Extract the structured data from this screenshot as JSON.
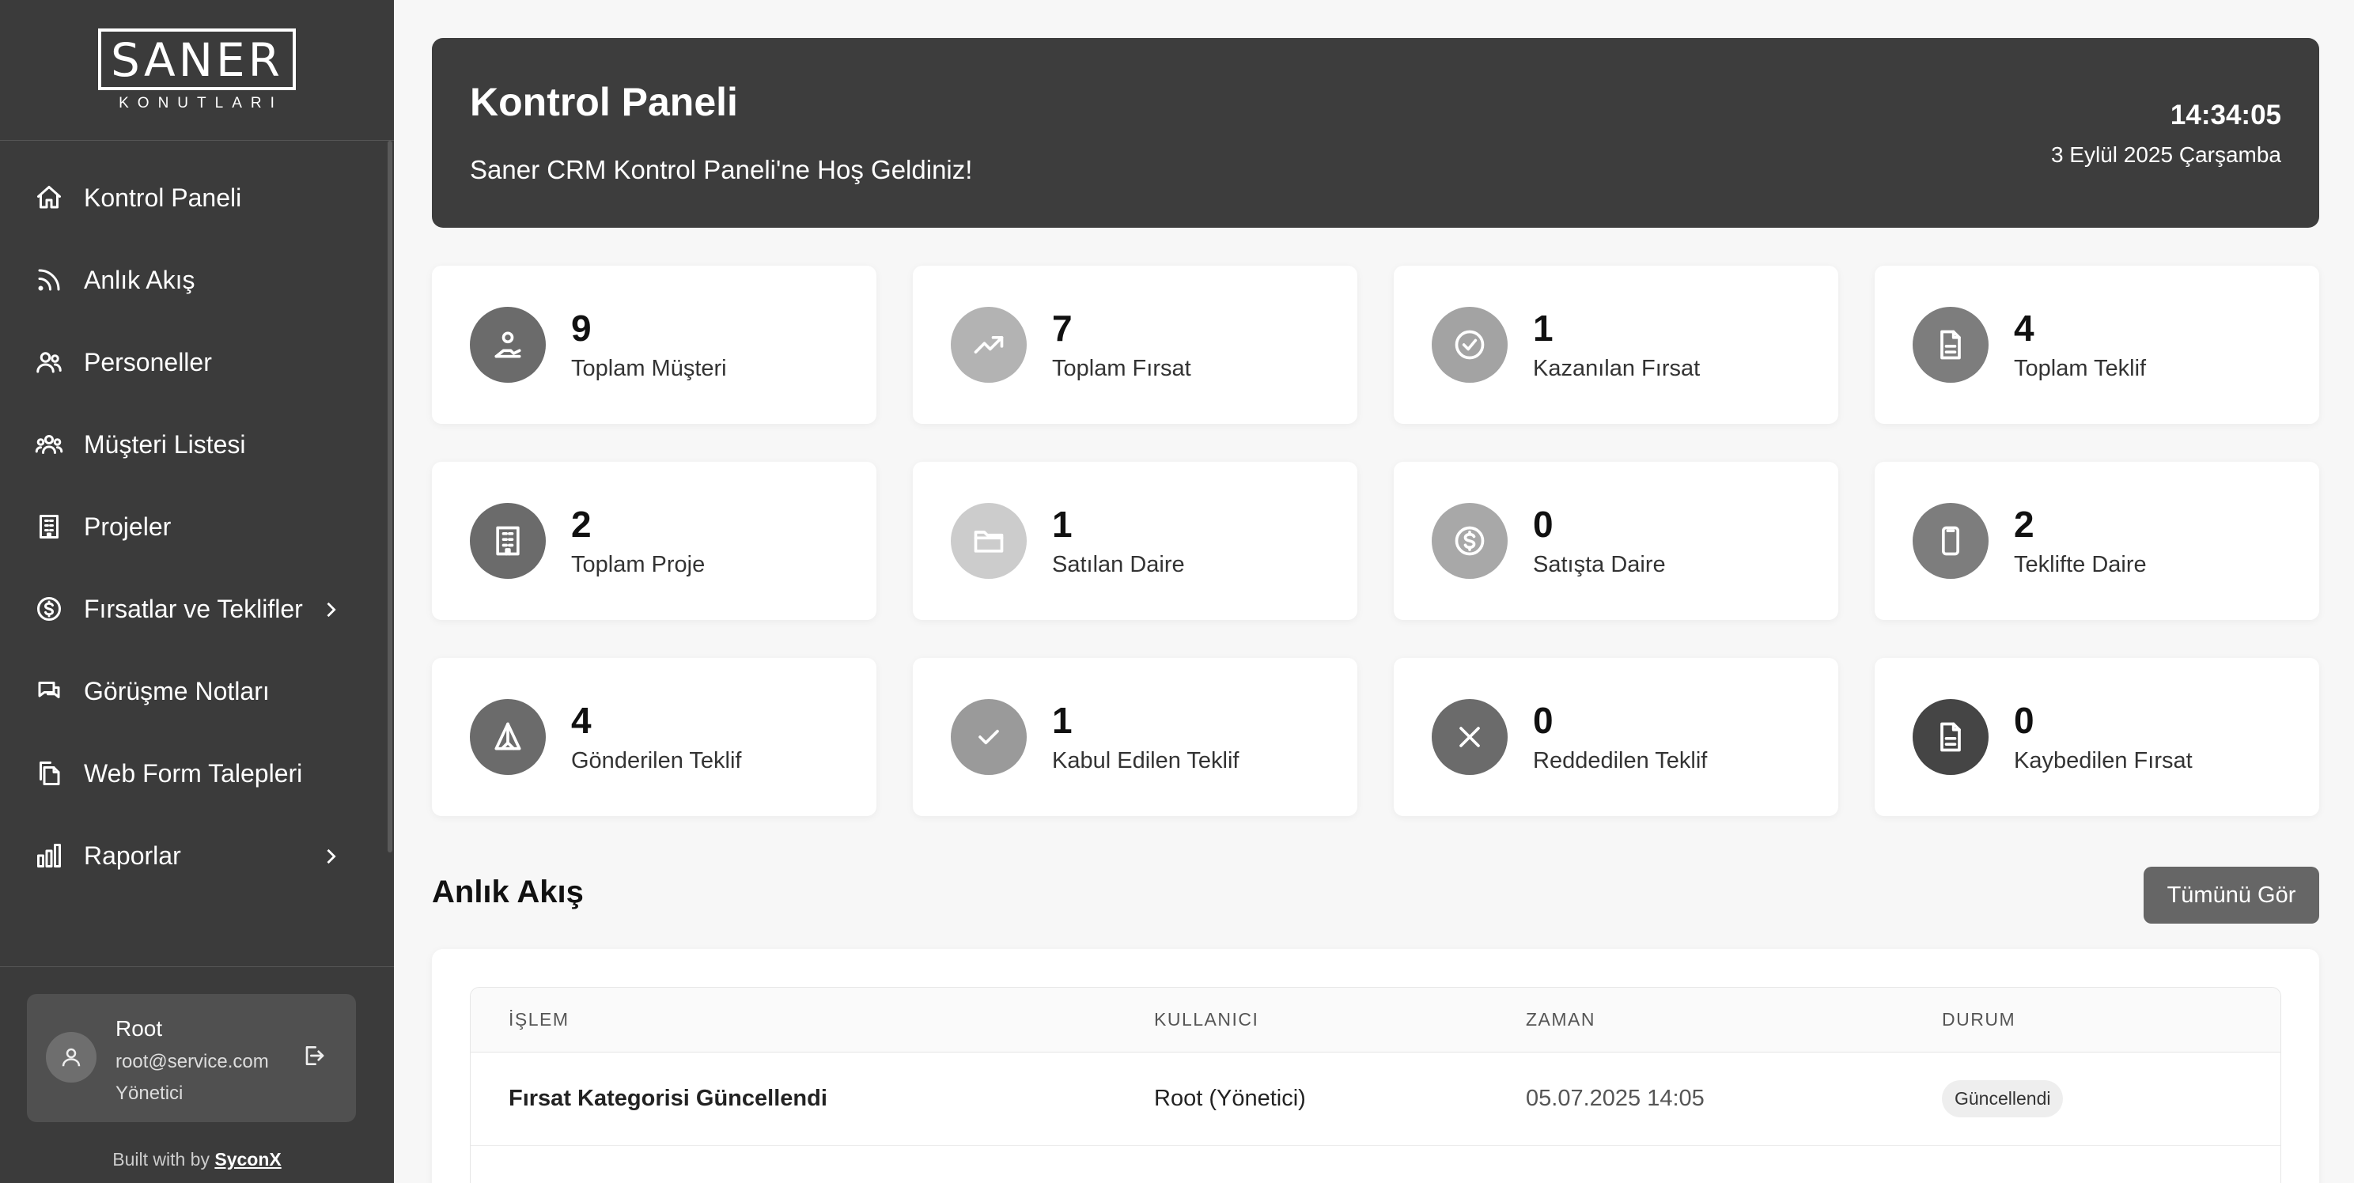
{
  "brand": {
    "name": "SANER",
    "sub": "KONUTLARI"
  },
  "sidebar": {
    "items": [
      {
        "label": "Kontrol Paneli",
        "icon": "home-icon"
      },
      {
        "label": "Anlık Akış",
        "icon": "rss-icon"
      },
      {
        "label": "Personeller",
        "icon": "users-icon"
      },
      {
        "label": "Müşteri Listesi",
        "icon": "user-group-icon"
      },
      {
        "label": "Projeler",
        "icon": "building-icon"
      },
      {
        "label": "Fırsatlar ve Teklifler",
        "icon": "dollar-circle-icon",
        "has_children": true
      },
      {
        "label": "Görüşme Notları",
        "icon": "chat-icon"
      },
      {
        "label": "Web Form Talepleri",
        "icon": "documents-icon"
      },
      {
        "label": "Raporlar",
        "icon": "bar-chart-icon",
        "has_children": true
      }
    ]
  },
  "user": {
    "name": "Root",
    "email": "root@service.com",
    "role": "Yönetici"
  },
  "footer": {
    "built_prefix": "Built with by",
    "built_brand": "SyconX"
  },
  "header": {
    "title": "Kontrol Paneli",
    "subtitle": "Saner CRM Kontrol Paneli'ne Hoş Geldiniz!",
    "time": "14:34:05",
    "date": "3 Eylül 2025 Çarşamba"
  },
  "stats": [
    {
      "value": "9",
      "label": "Toplam Müşteri",
      "icon": "user-hand-icon",
      "color": "#6b6b6b"
    },
    {
      "value": "7",
      "label": "Toplam Fırsat",
      "icon": "trending-up-icon",
      "color": "#b3b3b3"
    },
    {
      "value": "1",
      "label": "Kazanılan Fırsat",
      "icon": "check-circle-icon",
      "color": "#a3a3a3"
    },
    {
      "value": "4",
      "label": "Toplam Teklif",
      "icon": "document-icon",
      "color": "#7d7d7d"
    },
    {
      "value": "2",
      "label": "Toplam Proje",
      "icon": "building-icon",
      "color": "#6b6b6b"
    },
    {
      "value": "1",
      "label": "Satılan Daire",
      "icon": "folder-icon",
      "color": "#cccccc"
    },
    {
      "value": "0",
      "label": "Satışta Daire",
      "icon": "dollar-circle-icon",
      "color": "#a8a8a8"
    },
    {
      "value": "2",
      "label": "Teklifte Daire",
      "icon": "phone-icon",
      "color": "#7d7d7d"
    },
    {
      "value": "4",
      "label": "Gönderilen Teklif",
      "icon": "send-icon",
      "color": "#6b6b6b"
    },
    {
      "value": "1",
      "label": "Kabul Edilen Teklif",
      "icon": "check-icon",
      "color": "#9a9a9a"
    },
    {
      "value": "0",
      "label": "Reddedilen Teklif",
      "icon": "x-icon",
      "color": "#6b6b6b"
    },
    {
      "value": "0",
      "label": "Kaybedilen Fırsat",
      "icon": "document-icon",
      "color": "#454545"
    }
  ],
  "feed": {
    "title": "Anlık Akış",
    "see_all": "Tümünü Gör",
    "columns": [
      "İŞLEM",
      "KULLANICI",
      "ZAMAN",
      "DURUM"
    ],
    "rows": [
      {
        "action": "Fırsat Kategorisi Güncellendi",
        "user": "Root (Yönetici)",
        "time": "05.07.2025 14:05",
        "status": "Güncellendi"
      }
    ]
  }
}
